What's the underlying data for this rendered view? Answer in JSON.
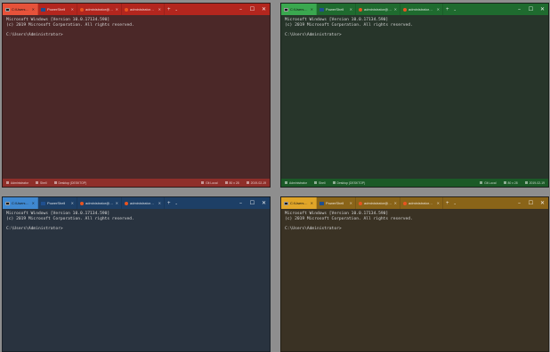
{
  "terminal": {
    "lines": [
      "Microsoft Windows [Version 10.0.17134.590]",
      "(c) 2019 Microsoft Corporation. All rights reserved.",
      "",
      "C:\\Users\\Administrator>"
    ]
  },
  "windows": [
    {
      "id": "red",
      "theme": {
        "bg": "#4b2828",
        "titlebar": "#b3261e",
        "active_tab": "#e6523a",
        "statusbar": "#8f2f2a"
      },
      "tabs": [
        {
          "icon": "cmd",
          "label": "C:\\Users\\Administr..."
        },
        {
          "icon": "ps",
          "label": "PowerShell"
        },
        {
          "icon": "ubuntu",
          "label": "administrator@DES..."
        },
        {
          "icon": "ubuntu",
          "label": "administrator@DES..."
        }
      ],
      "status_left": [
        "Administrator",
        "Shell",
        "Desktop (DESKTOP)"
      ],
      "status_right": [
        "Git Local",
        "80 x 28",
        "2019-02-19"
      ]
    },
    {
      "id": "green",
      "theme": {
        "bg": "#27352a",
        "titlebar": "#1f6b2f",
        "active_tab": "#3aa84f",
        "statusbar": "#1b5a27"
      },
      "tabs": [
        {
          "icon": "cmd",
          "label": "C:\\Users\\Administr..."
        },
        {
          "icon": "ps",
          "label": "PowerShell"
        },
        {
          "icon": "ubuntu",
          "label": "administrator@DES..."
        },
        {
          "icon": "ubuntu",
          "label": "administrator@DES..."
        }
      ],
      "status_left": [
        "Administrator",
        "Shell",
        "Desktop (DESKTOP)"
      ],
      "status_right": [
        "Git Local",
        "80 x 28",
        "2019-02-19"
      ]
    },
    {
      "id": "blue",
      "theme": {
        "bg": "#29333f",
        "titlebar": "#1d3f66",
        "active_tab": "#3f88d0",
        "statusbar": "#1d3f66"
      },
      "tabs": [
        {
          "icon": "cmd",
          "label": "C:\\Users\\Administr..."
        },
        {
          "icon": "ps",
          "label": "PowerShell"
        },
        {
          "icon": "ubuntu",
          "label": "administrator@DES..."
        },
        {
          "icon": "ubuntu",
          "label": "administrator@DES..."
        }
      ],
      "status_left": [],
      "status_right": []
    },
    {
      "id": "yellow",
      "theme": {
        "bg": "#3a3224",
        "titlebar": "#8a6418",
        "active_tab": "#e0a528",
        "statusbar": "#8a6418"
      },
      "tabs": [
        {
          "icon": "cmd",
          "label": "C:\\Users\\Administr..."
        },
        {
          "icon": "ps",
          "label": "PowerShell"
        },
        {
          "icon": "ubuntu",
          "label": "administrator@DES..."
        },
        {
          "icon": "ubuntu",
          "label": "administrator@DES..."
        }
      ],
      "status_left": [],
      "status_right": []
    }
  ],
  "controls": {
    "new_tab": "+",
    "dropdown": "⌄",
    "minimize": "–",
    "maximize": "☐",
    "close": "✕",
    "tab_close": "✕"
  }
}
